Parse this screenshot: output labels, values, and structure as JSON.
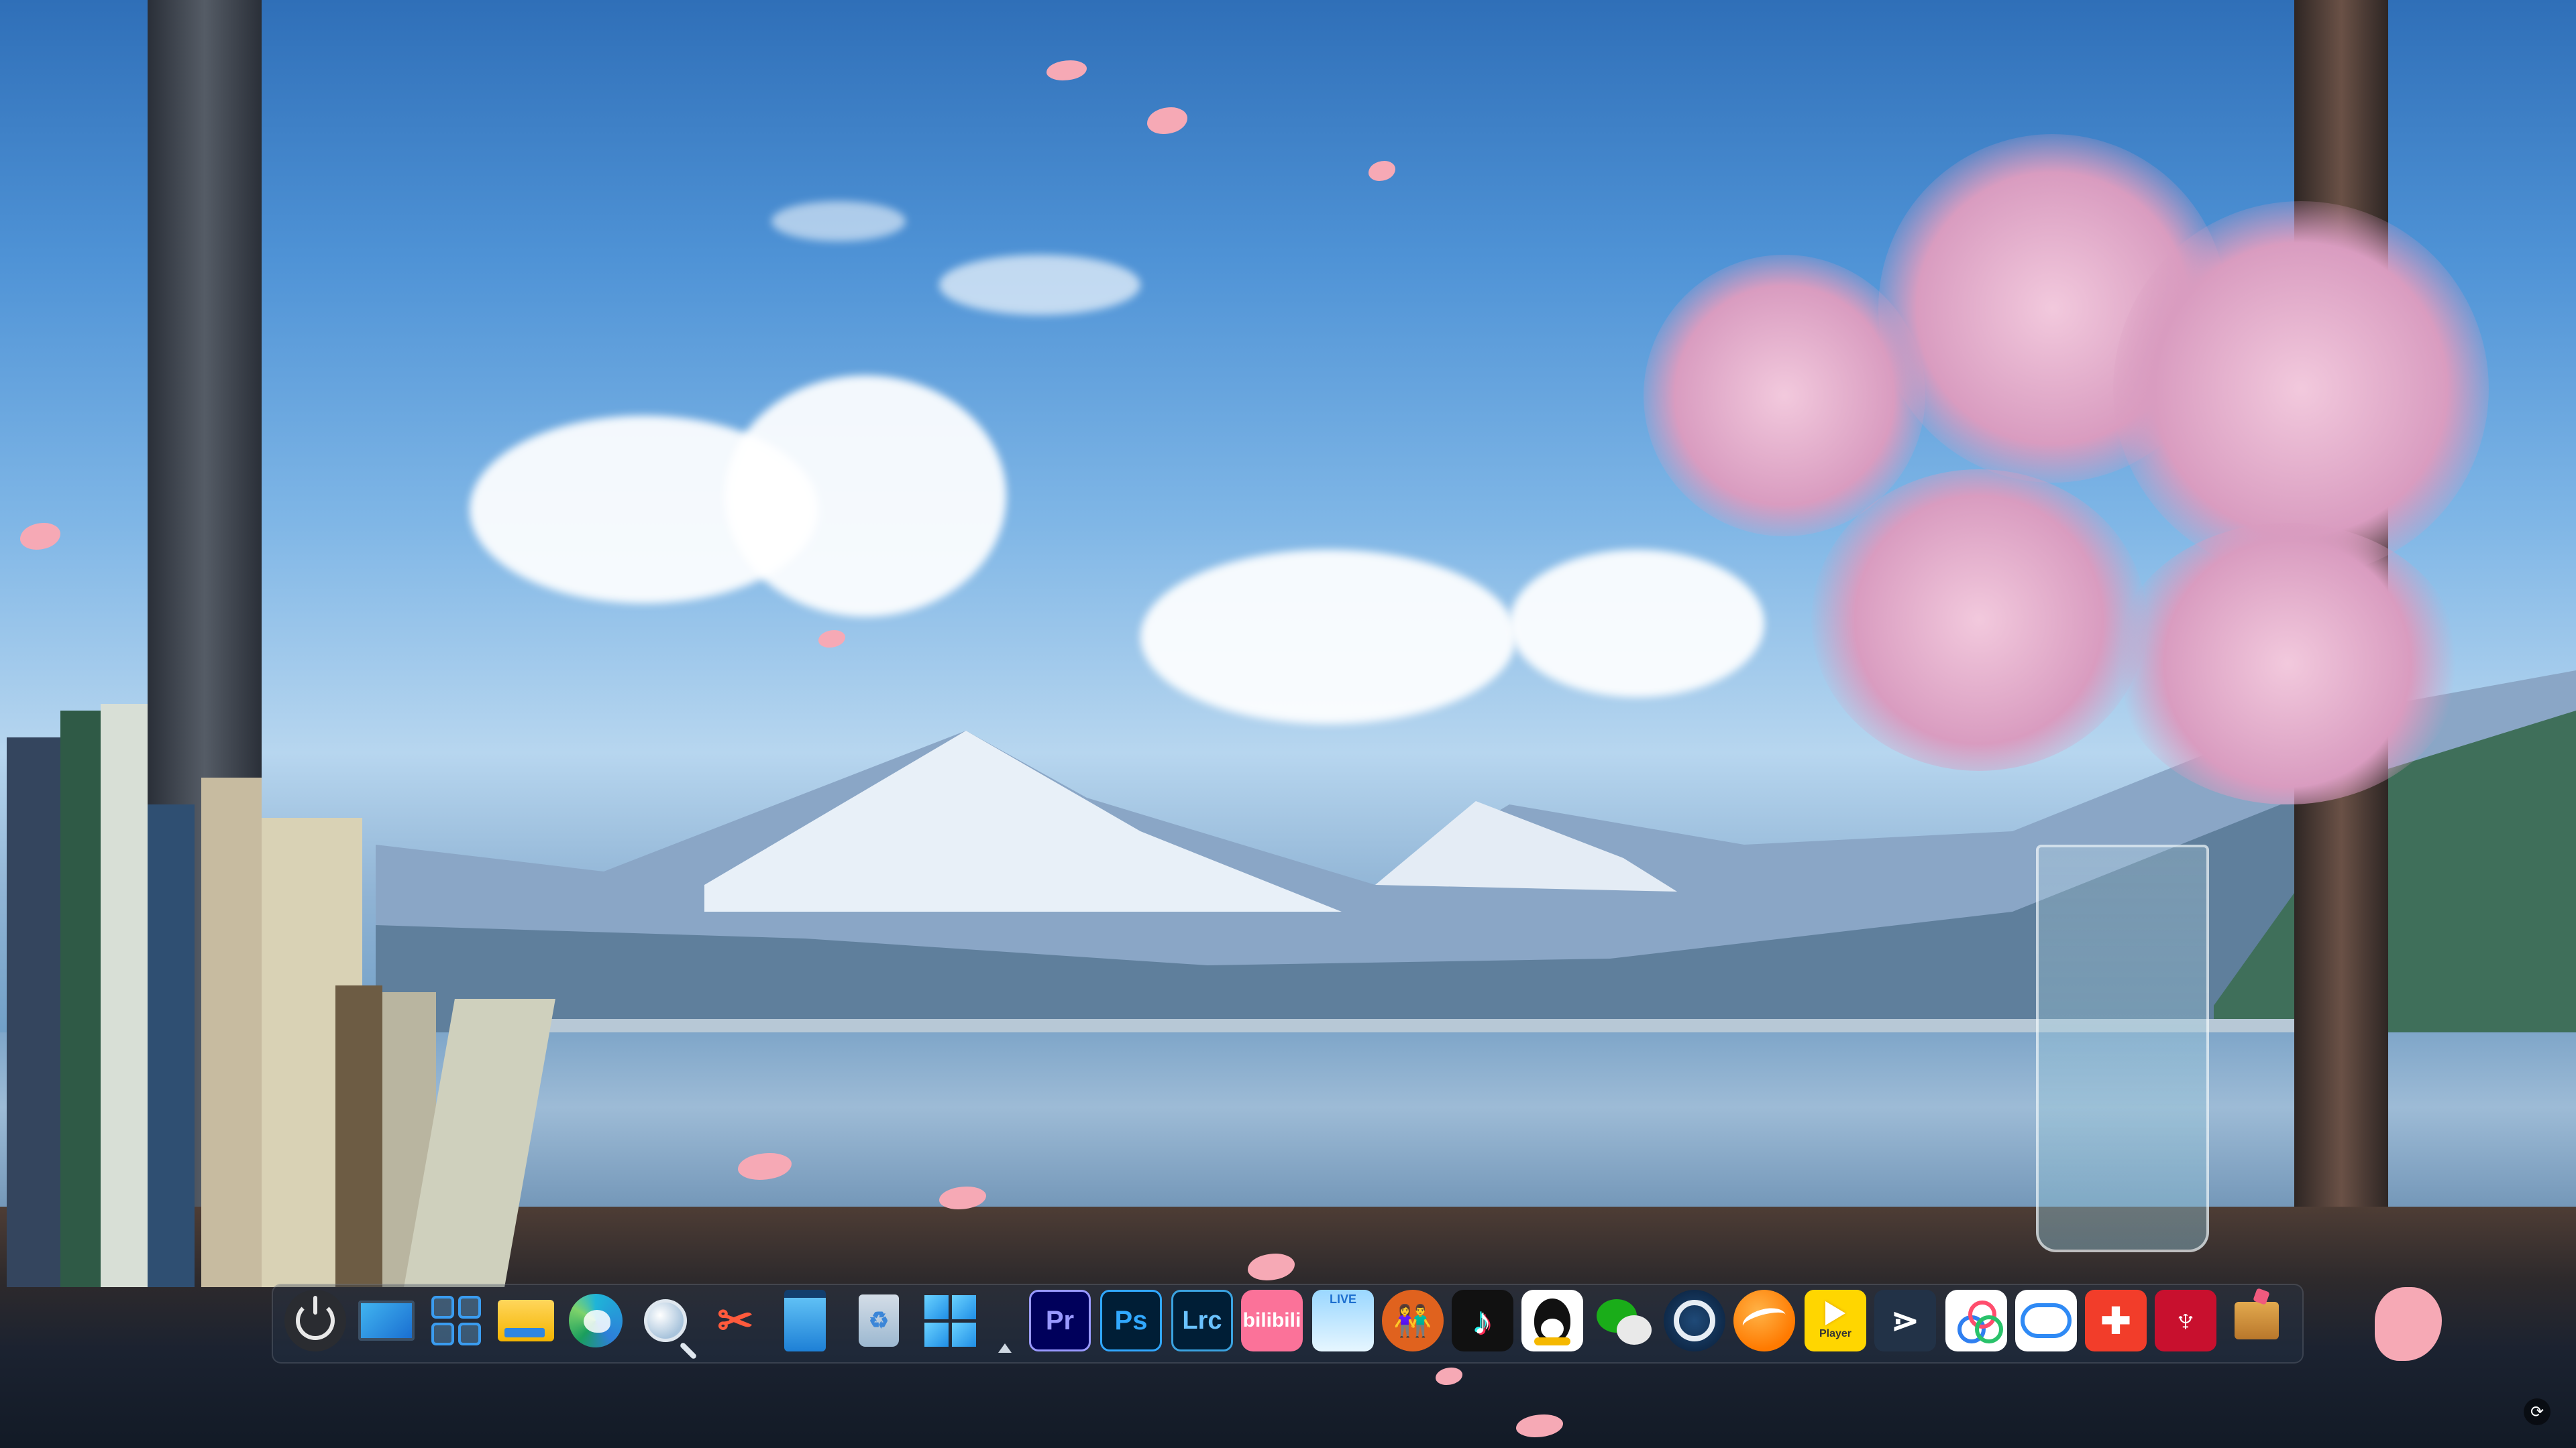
{
  "desktop": {
    "wallpaper": "anime-window-lake-mountain-blossoms",
    "accent": "#4f93d6"
  },
  "dock": {
    "items": [
      {
        "name": "power-button",
        "icon": "power-icon",
        "label": ""
      },
      {
        "name": "this-pc",
        "icon": "monitor-icon",
        "label": ""
      },
      {
        "name": "control-panel",
        "icon": "grid-icon",
        "label": ""
      },
      {
        "name": "file-explorer",
        "icon": "folder-icon",
        "label": ""
      },
      {
        "name": "microsoft-edge",
        "icon": "edge-icon",
        "label": ""
      },
      {
        "name": "search",
        "icon": "magnifier-icon",
        "label": ""
      },
      {
        "name": "snipping-tool",
        "icon": "scissors-icon",
        "label": ""
      },
      {
        "name": "notepad",
        "icon": "notepad-icon",
        "label": ""
      },
      {
        "name": "recycle-bin",
        "icon": "recycle-bin-icon",
        "label": ""
      },
      {
        "name": "start-menu",
        "icon": "windows-logo-icon",
        "label": ""
      },
      {
        "name": "adobe-premiere",
        "icon": "premiere-icon",
        "label": "Pr"
      },
      {
        "name": "adobe-photoshop",
        "icon": "photoshop-icon",
        "label": "Ps"
      },
      {
        "name": "adobe-lightroom-classic",
        "icon": "lightroom-icon",
        "label": "Lrc"
      },
      {
        "name": "bilibili",
        "icon": "bilibili-icon",
        "label": "bilibili"
      },
      {
        "name": "bilibili-live",
        "icon": "live-icon",
        "label": "LIVE"
      },
      {
        "name": "people-app",
        "icon": "people-icon",
        "label": ""
      },
      {
        "name": "tiktok",
        "icon": "tiktok-icon",
        "label": ""
      },
      {
        "name": "qq",
        "icon": "qq-penguin-icon",
        "label": ""
      },
      {
        "name": "wechat",
        "icon": "wechat-icon",
        "label": ""
      },
      {
        "name": "steam",
        "icon": "steam-icon",
        "label": ""
      },
      {
        "name": "orange-app",
        "icon": "orange-swoosh-icon",
        "label": ""
      },
      {
        "name": "potplayer",
        "icon": "play-icon",
        "label": "Player"
      },
      {
        "name": "terminal-app",
        "icon": "chevron-right-icon",
        "label": ""
      },
      {
        "name": "baidu-netdisk",
        "icon": "rings-icon",
        "label": ""
      },
      {
        "name": "cloud-drive",
        "icon": "cloud-icon",
        "label": ""
      },
      {
        "name": "xmind",
        "icon": "xmind-icon",
        "label": ""
      },
      {
        "name": "adobe-acrobat",
        "icon": "acrobat-icon",
        "label": ""
      },
      {
        "name": "toolbox",
        "icon": "box-icon",
        "label": ""
      }
    ],
    "colors": {
      "premiere": "#9999ff",
      "photoshop": "#31a8ff",
      "bilibili": "#fb7299",
      "acrobat": "#c8102e",
      "xmind": "#f23d2a"
    }
  },
  "glyphs": {
    "scissors": "✂",
    "people": "👫",
    "tiktok": "♪",
    "dash": "⋗",
    "xmind": "✚",
    "acrobat": "♆",
    "recycle": "♻",
    "tray": "⟳"
  }
}
